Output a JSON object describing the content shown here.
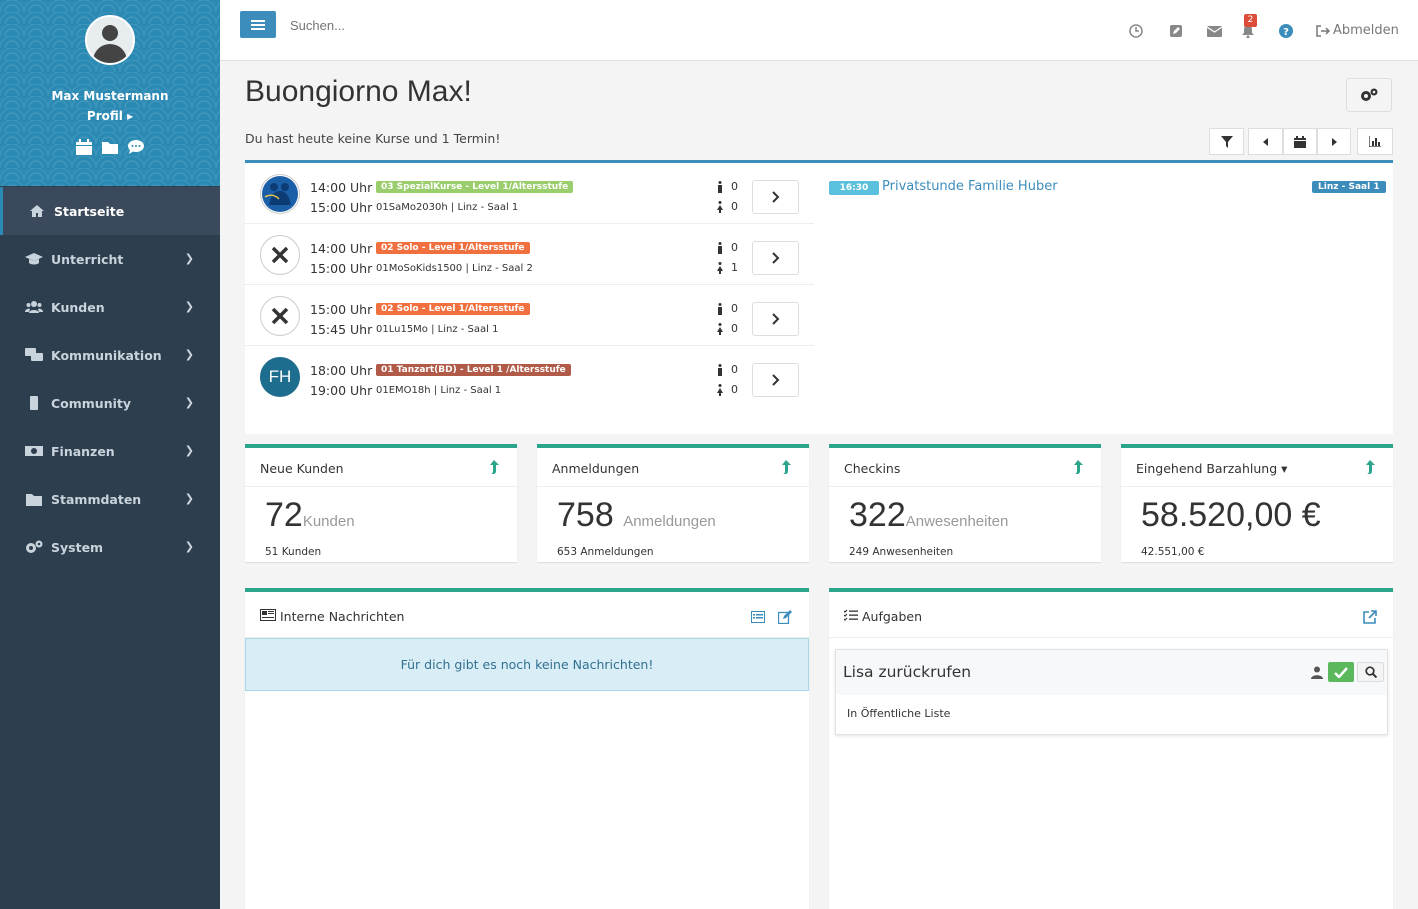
{
  "user": {
    "name": "Max Mustermann",
    "profile_label": "Profil"
  },
  "nav": [
    {
      "label": "Startseite",
      "icon": "home-icon",
      "active": true
    },
    {
      "label": "Unterricht",
      "icon": "graduation-cap-icon"
    },
    {
      "label": "Kunden",
      "icon": "users-icon"
    },
    {
      "label": "Kommunikation",
      "icon": "comments-icon"
    },
    {
      "label": "Community",
      "icon": "mobile-icon"
    },
    {
      "label": "Finanzen",
      "icon": "money-icon"
    },
    {
      "label": "Stammdaten",
      "icon": "folder-icon"
    },
    {
      "label": "System",
      "icon": "cogs-icon"
    }
  ],
  "topbar": {
    "search_placeholder": "Suchen...",
    "notification_count": "2",
    "logout_label": "Abmelden"
  },
  "page": {
    "title": "Buongiorno Max!",
    "subtitle": "Du hast heute keine Kurse und 1 Termin!"
  },
  "courses": [
    {
      "start": "14:00 Uhr",
      "end": "15:00 Uhr",
      "label": "03 SpezialKurse - Level 1/Altersstufe",
      "label_color": "#8bc34a",
      "room": "01SaMo2030h | Linz - Saal 1",
      "male": "0",
      "female": "0",
      "avatar": "dance"
    },
    {
      "start": "14:00 Uhr",
      "end": "15:00 Uhr",
      "label": "02 Solo - Level 1/Altersstufe",
      "label_color": "#f0703f",
      "room": "01MoSoKids1500 | Linz - Saal 2",
      "male": "0",
      "female": "1",
      "avatar": "x"
    },
    {
      "start": "15:00 Uhr",
      "end": "15:45 Uhr",
      "label": "02 Solo - Level 1/Altersstufe",
      "label_color": "#f0703f",
      "room": "01Lu15Mo | Linz - Saal 1",
      "male": "0",
      "female": "0",
      "avatar": "x"
    },
    {
      "start": "18:00 Uhr",
      "end": "19:00 Uhr",
      "label": "01 Tanzart(BD) - Level 1 /Altersstufe",
      "label_color": "#b05a47",
      "room": "01EMO18h | Linz - Saal 1",
      "male": "0",
      "female": "0",
      "avatar": "FH"
    }
  ],
  "appointment": {
    "time": "16:30",
    "title": "Privatstunde Familie Huber",
    "room": "Linz - Saal 1"
  },
  "stats": [
    {
      "title": "Neue Kunden",
      "value": "72",
      "unit": "Kunden",
      "sub": "51 Kunden"
    },
    {
      "title": "Anmeldungen",
      "value": "758",
      "unit": "Anmeldungen",
      "sub": "653 Anmeldungen"
    },
    {
      "title": "Checkins",
      "value": "322",
      "unit": "Anwesenheiten",
      "sub": "249 Anwesenheiten"
    },
    {
      "title": "Eingehend Barzahlung",
      "value": "58.520,00 €",
      "unit": "",
      "sub": "42.551,00 €"
    }
  ],
  "messages": {
    "title": "Interne Nachrichten",
    "empty": "Für dich gibt es noch keine Nachrichten!"
  },
  "tasks": {
    "title": "Aufgaben",
    "items": [
      {
        "title": "Lisa zurückrufen",
        "list": "In Öffentliche Liste"
      }
    ]
  },
  "colors": {
    "sidebar": "#2d3e4f",
    "accent": "#3c8dbc",
    "teal": "#2ca58d",
    "success": "#5cb85c"
  }
}
